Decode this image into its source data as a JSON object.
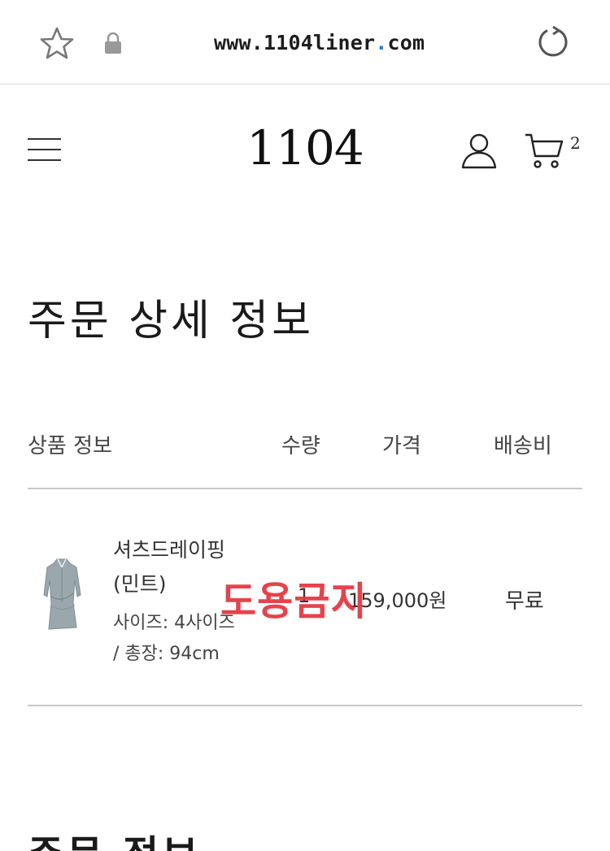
{
  "browser": {
    "url_prefix": "www.1104liner",
    "url_dot": ".",
    "url_suffix": "com",
    "icons": [
      "star-icon",
      "lock-icon",
      "reload-icon"
    ]
  },
  "header": {
    "logo": "1104",
    "cart_count": "2",
    "icons": [
      "hamburger-menu-icon",
      "user-icon",
      "cart-icon"
    ]
  },
  "page": {
    "title": "주문 상세 정보",
    "next_section_title": "주문 정보"
  },
  "table": {
    "headers": {
      "product": "상품 정보",
      "quantity": "수량",
      "price": "가격",
      "shipping": "배송비"
    },
    "rows": [
      {
        "name_line1": "셔츠드레이핑",
        "name_line2": "(민트)",
        "option_line1": "사이즈: 4사이즈",
        "option_line2": "/ 총장: 94cm",
        "quantity": "1",
        "price": "159,000원",
        "shipping": "무료"
      }
    ]
  },
  "watermark": "도용금지",
  "colors": {
    "watermark": "#e3343d",
    "url_dot": "#1e7fd6",
    "text": "#222222",
    "rule": "#c8c8c8"
  }
}
